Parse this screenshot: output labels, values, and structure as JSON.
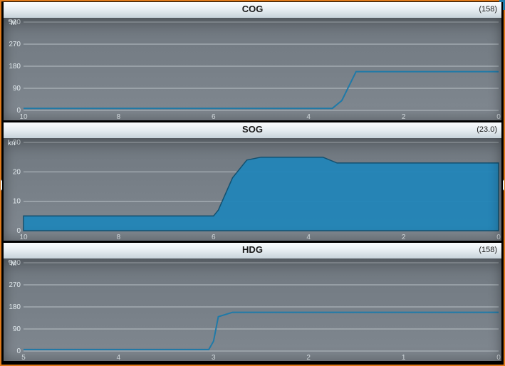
{
  "panels": [
    {
      "id": "cog",
      "title": "COG",
      "unit": "°M",
      "value": "(158)"
    },
    {
      "id": "sog",
      "title": "SOG",
      "unit": "kn",
      "value": "(23.0)"
    },
    {
      "id": "hdg",
      "title": "HDG",
      "unit": "°M",
      "value": "(158)"
    }
  ],
  "chart_data": [
    {
      "type": "line",
      "title": "COG",
      "ylabel": "°M",
      "xlabel": "",
      "x_direction": "right_to_left",
      "xlim": [
        0,
        10
      ],
      "ylim": [
        0,
        360
      ],
      "x_ticks": [
        10,
        8,
        6,
        4,
        2,
        0
      ],
      "y_ticks": [
        0,
        90,
        180,
        270,
        360
      ],
      "x": [
        10,
        9,
        8,
        7,
        6,
        5,
        4,
        3.5,
        3.3,
        3.0,
        2.5,
        2,
        1,
        0
      ],
      "y": [
        8,
        8,
        8,
        8,
        8,
        8,
        8,
        8,
        40,
        158,
        158,
        158,
        158,
        158
      ],
      "fill": false,
      "current": 158
    },
    {
      "type": "area",
      "title": "SOG",
      "ylabel": "kn",
      "xlabel": "",
      "x_direction": "right_to_left",
      "xlim": [
        0,
        10
      ],
      "ylim": [
        0,
        30
      ],
      "x_ticks": [
        10,
        8,
        6,
        4,
        2,
        0
      ],
      "y_ticks": [
        0,
        10,
        20,
        30
      ],
      "x": [
        10,
        9,
        8,
        7,
        6,
        5.9,
        5.6,
        5.3,
        5,
        4,
        3.7,
        3.4,
        3,
        2,
        1,
        0
      ],
      "y": [
        5,
        5,
        5,
        5,
        5,
        7,
        18,
        24,
        25,
        25,
        25,
        23,
        23,
        23,
        23,
        23
      ],
      "fill": true,
      "current": 23.0
    },
    {
      "type": "line",
      "title": "HDG",
      "ylabel": "°M",
      "xlabel": "",
      "x_direction": "right_to_left",
      "xlim": [
        0,
        5
      ],
      "ylim": [
        0,
        360
      ],
      "x_ticks": [
        5,
        4,
        3,
        2,
        1,
        0
      ],
      "y_ticks": [
        0,
        90,
        180,
        270,
        360
      ],
      "x": [
        5,
        4.5,
        4,
        3.5,
        3.05,
        3.0,
        2.95,
        2.8,
        2.5,
        2,
        1,
        0
      ],
      "y": [
        6,
        6,
        6,
        6,
        6,
        40,
        140,
        158,
        158,
        158,
        158,
        158
      ],
      "fill": false,
      "current": 158
    }
  ]
}
